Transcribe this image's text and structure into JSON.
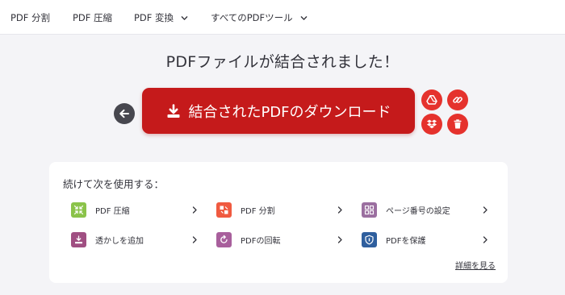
{
  "nav": {
    "items": [
      {
        "label": "PDF 分割"
      },
      {
        "label": "PDF 圧縮"
      },
      {
        "label": "PDF 変換"
      },
      {
        "label": "すべてのPDFツール"
      }
    ]
  },
  "headline": "PDFファイルが結合されました！",
  "download": {
    "label": "結合されたPDFのダウンロード"
  },
  "share_actions": {
    "icons": [
      "google-drive-icon",
      "link-icon",
      "dropbox-icon",
      "trash-icon"
    ]
  },
  "continue": {
    "title": "続けて次を使用する：",
    "tools": [
      {
        "label": "PDF 圧縮",
        "color": "#8bc34a"
      },
      {
        "label": "PDF 分割",
        "color": "#f05a40"
      },
      {
        "label": "ページ番号の設定",
        "color": "#9b6fa0"
      },
      {
        "label": "透かしを追加",
        "color": "#a04f82"
      },
      {
        "label": "PDFの回転",
        "color": "#a85f9c"
      },
      {
        "label": "PDFを保護",
        "color": "#2f5f9e"
      }
    ],
    "more_label": "詳細を見る"
  },
  "colors": {
    "accent": "#e5322d",
    "download_bg": "#c51a1b",
    "back_button": "#47474f",
    "background": "#f4f4f7"
  }
}
